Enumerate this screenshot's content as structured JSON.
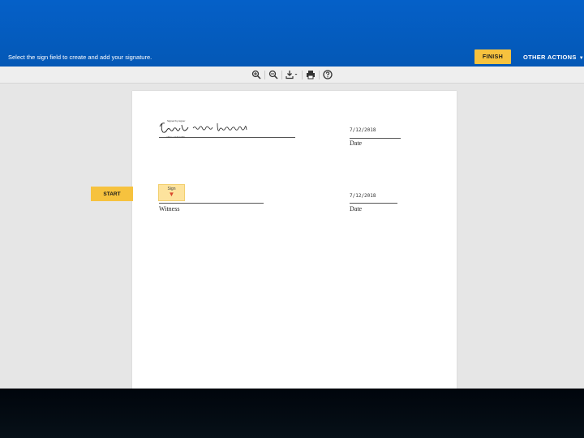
{
  "header": {
    "instruction": "Select the sign field to create and add your signature.",
    "finish_label": "FINISH",
    "other_actions_label": "OTHER ACTIONS"
  },
  "toolbar": {
    "tools": [
      "zoom-in-icon",
      "zoom-out-icon",
      "download-icon",
      "print-icon",
      "help-icon"
    ]
  },
  "document": {
    "signature_header": "Signed by signer",
    "signature_caption": "ABC1 2345 6789",
    "signed_date": "7/12/2018",
    "witness_date": "7/12/2018",
    "date_label": "Date",
    "witness_label": "Witness",
    "sign_field_label": "Sign"
  },
  "start_label": "START",
  "colors": {
    "header_blue": "#0560c8",
    "accent_yellow": "#f6c23e",
    "sign_field_fill": "#fde39d"
  }
}
